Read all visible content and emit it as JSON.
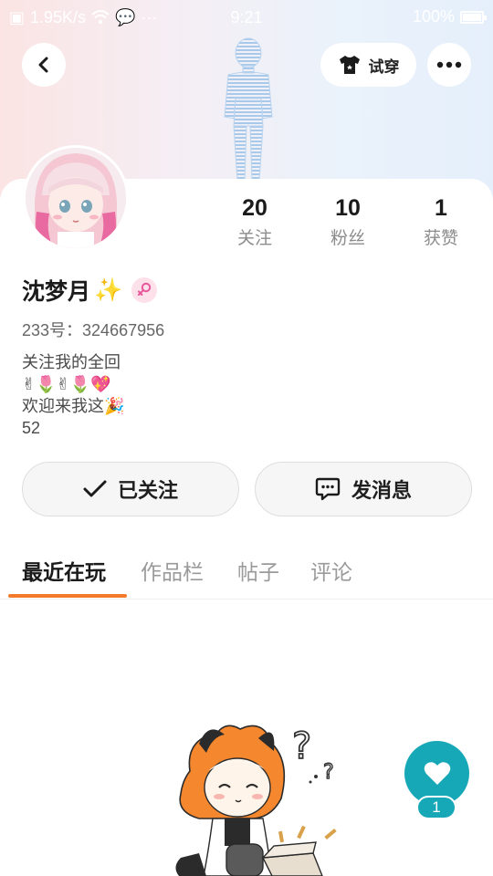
{
  "status_bar": {
    "net_speed": "1.95K/s",
    "time": "9:21",
    "battery": "100%",
    "battery_level": 1.0
  },
  "header": {
    "tryon_label": "试穿"
  },
  "profile": {
    "stats": [
      {
        "value": "20",
        "label": "关注"
      },
      {
        "value": "10",
        "label": "粉丝"
      },
      {
        "value": "1",
        "label": "获赞"
      }
    ],
    "name": "沈梦月",
    "name_emoji": "✨",
    "uid": "233号：324667956",
    "bio": [
      "关注我的全回",
      "✌🌷✌🌷💖",
      "欢迎来我这🎉",
      "52"
    ]
  },
  "actions": {
    "follow_label": "已关注",
    "message_label": "发消息"
  },
  "tabs": [
    "最近在玩",
    "作品栏",
    "帖子",
    "评论"
  ],
  "like_fab": {
    "count": "1"
  },
  "colors": {
    "accent_orange": "#f27a2a",
    "fab_teal": "#17a8b8",
    "gender_pink": "#e9579a"
  },
  "icons": [
    "back-arrow-icon",
    "tshirt-icon",
    "more-dots-icon",
    "checkmark-icon",
    "chat-bubble-icon",
    "heart-icon",
    "female-symbol-icon",
    "wifi-icon"
  ]
}
